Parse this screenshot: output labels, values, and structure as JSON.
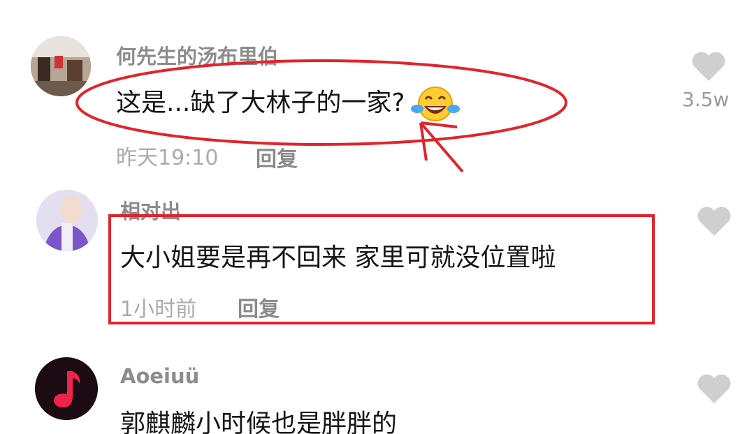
{
  "comments": [
    {
      "username": "何先生的汤布里伯",
      "text": "这是...缺了大林子的一家?",
      "time": "昨天19:10",
      "reply_label": "回复",
      "likes": "3.5w",
      "avatar_icon": "photo-avatar",
      "emoji_icon": "tears-of-joy-emoji"
    },
    {
      "username": "相对出",
      "text": "大小姐要是再不回来 家里可就没位置啦",
      "time": "1小时前",
      "reply_label": "回复",
      "likes": "",
      "avatar_icon": "purple-portrait-avatar"
    },
    {
      "username": "Aoeiuü",
      "text": "郭麒麟小时候也是胖胖的",
      "avatar_icon": "music-note-avatar",
      "likes": ""
    }
  ],
  "colors": {
    "annotation_red": "#e0242c",
    "heart_gray": "#cfcfcf",
    "music_red": "#f0234a"
  }
}
